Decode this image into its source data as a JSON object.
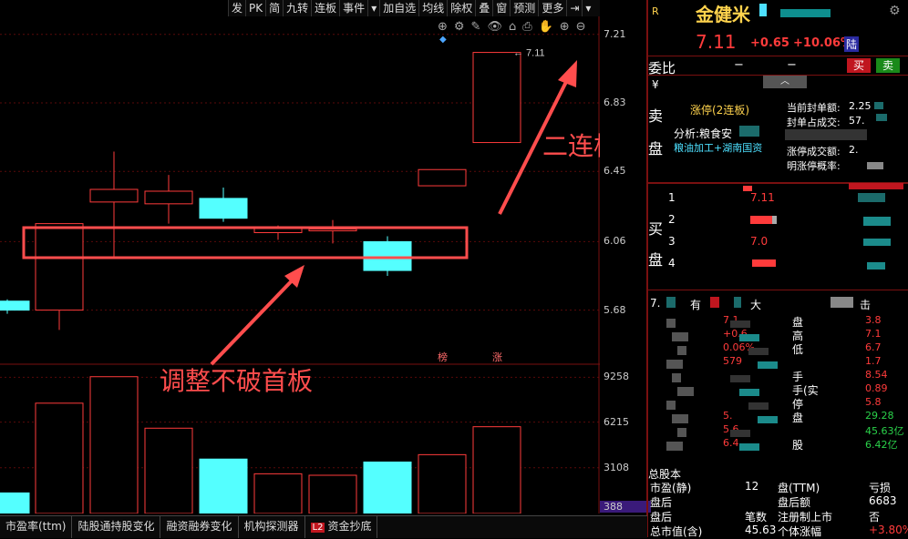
{
  "toolbar": {
    "items": [
      "发",
      "PK",
      "简",
      "九转",
      "连板",
      "事件",
      "▾",
      "加自选",
      "均线",
      "除权",
      "叠",
      "窗",
      "预测",
      "更多",
      "⇥",
      "▾"
    ]
  },
  "chart_data": {
    "type": "candlestick",
    "price_ticks": [
      "7.21",
      "6.83",
      "6.45",
      "6.06",
      "5.68"
    ],
    "volume_ticks": [
      "9258",
      "6215",
      "3108",
      "388"
    ],
    "last_price_marker": "7.11",
    "candles": [
      {
        "open": 5.68,
        "close": 5.73,
        "high": 5.74,
        "low": 5.66,
        "dir": "down"
      },
      {
        "open": 5.68,
        "close": 6.16,
        "high": 6.16,
        "low": 5.57,
        "dir": "up"
      },
      {
        "open": 6.28,
        "close": 6.35,
        "high": 6.56,
        "low": 5.97,
        "dir": "up"
      },
      {
        "open": 6.34,
        "close": 6.27,
        "high": 6.43,
        "low": 6.16,
        "dir": "up"
      },
      {
        "open": 6.3,
        "close": 6.19,
        "high": 6.36,
        "low": 6.17,
        "dir": "down"
      },
      {
        "open": 6.11,
        "close": 6.14,
        "high": 6.15,
        "low": 6.07,
        "dir": "up"
      },
      {
        "open": 6.12,
        "close": 6.13,
        "high": 6.18,
        "low": 6.05,
        "dir": "up"
      },
      {
        "open": 6.06,
        "close": 5.9,
        "high": 6.09,
        "low": 5.87,
        "dir": "down"
      },
      {
        "open": 6.37,
        "close": 6.46,
        "high": 6.46,
        "low": 6.37,
        "dir": "up"
      },
      {
        "open": 6.61,
        "close": 7.11,
        "high": 7.11,
        "low": 6.61,
        "dir": "up"
      }
    ],
    "volumes": [
      {
        "v": 1400,
        "dir": "down"
      },
      {
        "v": 7500,
        "dir": "up"
      },
      {
        "v": 9300,
        "dir": "up"
      },
      {
        "v": 5800,
        "dir": "up"
      },
      {
        "v": 3700,
        "dir": "down"
      },
      {
        "v": 2700,
        "dir": "up"
      },
      {
        "v": 2600,
        "dir": "up"
      },
      {
        "v": 3500,
        "dir": "down"
      },
      {
        "v": 4000,
        "dir": "up"
      },
      {
        "v": 5900,
        "dir": "up"
      }
    ],
    "badges": [
      "榜",
      "涨"
    ]
  },
  "annotations": {
    "highlight_box_label": "调整不破首板",
    "arrow_label": "二连板"
  },
  "bottom_tabs": [
    "市盈率(ttm)",
    "陆股通持股变化",
    "融资融券变化",
    "机构探测器",
    "资金抄底"
  ],
  "bottom_tab_l2": "L2",
  "right": {
    "badge_r": "R",
    "stock_name": "金健米",
    "price": "7.11",
    "change": "+0.65",
    "change_pct": "+10.06%",
    "land_badge": "陆",
    "weibi_label": "委比",
    "weibi_val": "−",
    "weicha_val": "−",
    "buy_btn": "买",
    "sell_btn": "卖",
    "yen": "¥",
    "sell_side": [
      "卖",
      "盘"
    ],
    "limit_up": "涨停(2连板)",
    "analysis": "分析:粮食安",
    "concept": "粮油加工+湖南国资",
    "info": [
      {
        "k": "当前封单额:",
        "v": "2.25"
      },
      {
        "k": "封单占成交:",
        "v": "57."
      },
      {
        "k": "涨停成交额:",
        "v": "2."
      },
      {
        "k": "明涨停概率:",
        "v": ""
      }
    ],
    "buy_side": [
      "买",
      "盘"
    ],
    "bids": [
      {
        "n": "1",
        "p": "7.11"
      },
      {
        "n": "2",
        "p": ""
      },
      {
        "n": "3",
        "p": "7.0"
      },
      {
        "n": "4",
        "p": ""
      }
    ],
    "detail_header": [
      "7.",
      "有",
      "大",
      "击"
    ],
    "detail_rows": [
      {
        "l": "7.1",
        "lk": "盘",
        "r": "3.8"
      },
      {
        "l": "+0.6",
        "lk": "高",
        "r": "7.1"
      },
      {
        "l": "0.06%",
        "lk": "低",
        "r": "6.7"
      },
      {
        "l": "579",
        "lk": "",
        "r": "1.7"
      },
      {
        "l": "",
        "lk": "手",
        "r": "8.54"
      },
      {
        "l": "",
        "lk": "手(实",
        "r": "0.89"
      },
      {
        "l": "",
        "lk": "停",
        "r": "5.8"
      },
      {
        "l": "5.",
        "lk": "盘",
        "r": "29.28"
      },
      {
        "l": "5.6",
        "lk": "",
        "r": "45.63亿"
      },
      {
        "l": "6.4",
        "lk": "股",
        "r": "6.42亿"
      }
    ],
    "bottom_rows": [
      {
        "l": "市盈(静)",
        "m": "12",
        "k": "盘(TTM)",
        "r": "亏损"
      },
      {
        "l": "盘后",
        "m": "",
        "k": "盘后额",
        "r": "6683"
      },
      {
        "l": "盘后",
        "m": "笔数",
        "k": "注册制上市",
        "r": "否"
      },
      {
        "l": "总市值(含)",
        "m": "45.63",
        "k": "个体涨幅",
        "r": "+3.80%"
      }
    ],
    "total_label": "总股本"
  }
}
